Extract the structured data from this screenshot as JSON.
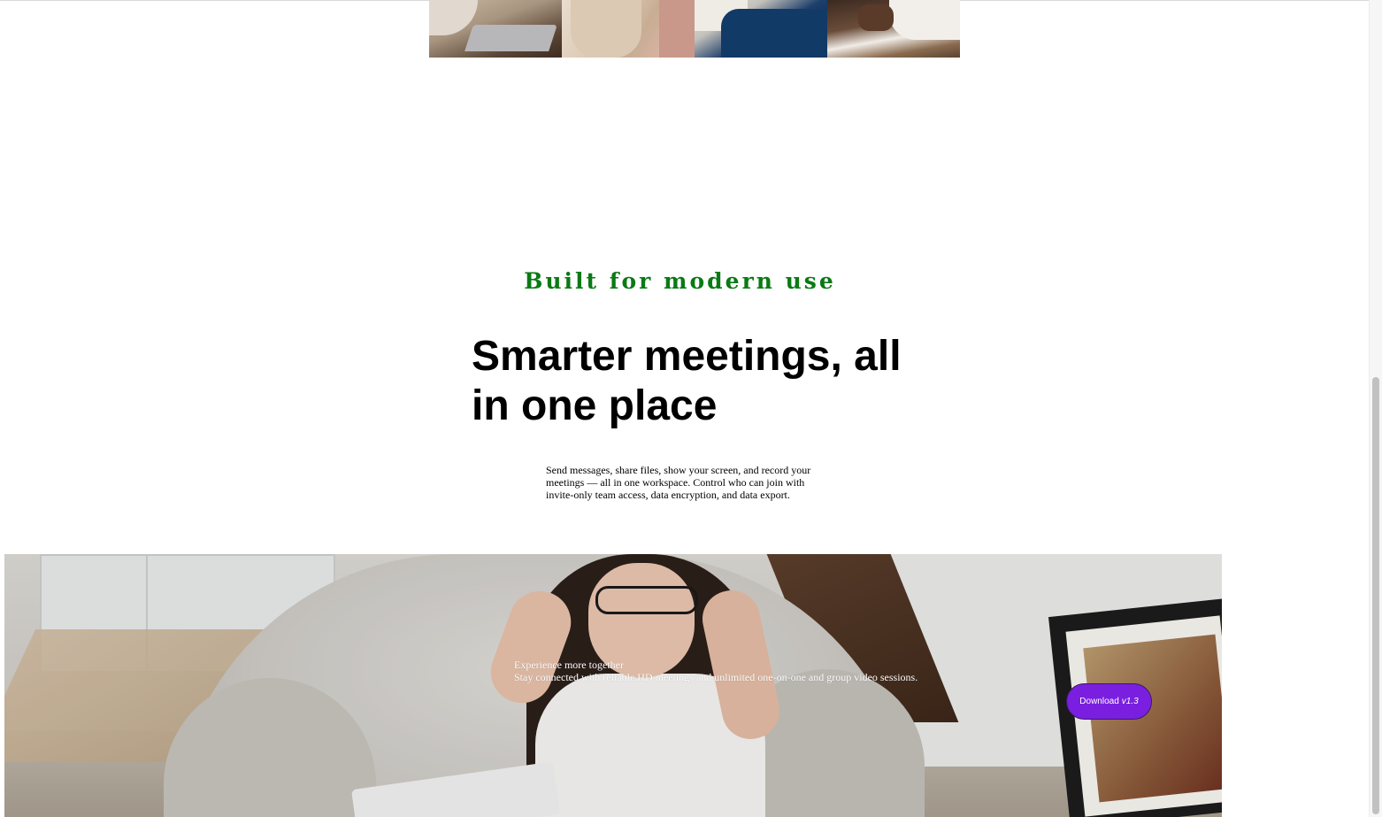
{
  "gallery": {
    "photos": [
      {
        "subject": "person-with-laptop"
      },
      {
        "subject": "people-in-conversation"
      },
      {
        "subject": "meeting-with-documents"
      },
      {
        "subject": "person-holding-phone"
      }
    ]
  },
  "section": {
    "eyebrow": "Built for modern use",
    "headline": "Smarter meetings, all in one place",
    "description": "Send messages, share files, show your screen, and record your meetings — all in one workspace. Control who can join with invite-only team access, data encryption, and data export."
  },
  "hero": {
    "caption_title": "Experience more together",
    "caption_text": "Stay connected with reliable HD meetings and unlimited one-on-one and group video sessions.",
    "download_label": "Download",
    "download_version": "v1.3"
  },
  "colors": {
    "eyebrow": "#0a7a14",
    "button": "#7a1fe0",
    "button_border": "#3a1a63",
    "text": "#000000"
  }
}
